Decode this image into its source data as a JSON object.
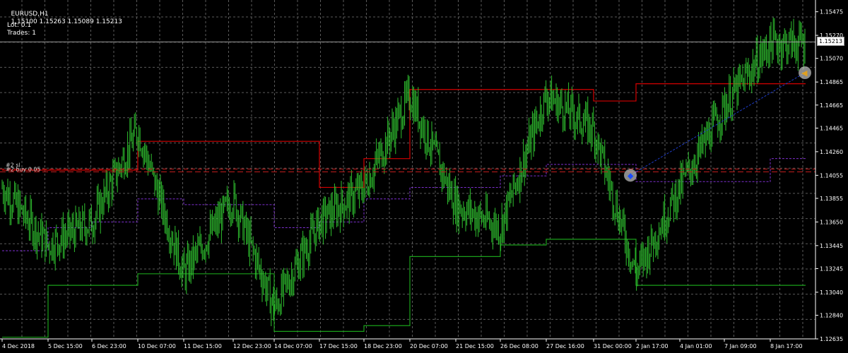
{
  "header": {
    "symbol": "EURUSD,H1",
    "ohlc": "1.15100 1.15263 1.15089 1.15213"
  },
  "overlay": {
    "lot": "Lot: 0.1",
    "trades": "Trades: 1",
    "sl_label": "#2 sl",
    "buy_label": "#2 buy 0.05"
  },
  "current_price": "1.15213",
  "colors": {
    "background": "#000000",
    "grid": "#5a5a5a",
    "candle": "#2fbf2f",
    "upper_band": "#d40000",
    "lower_band": "#1aa01a",
    "mid_band": "#7e2fd0",
    "order_line": "#c81e1e",
    "trend_line": "#1e3cc8",
    "order_marker": "#b8b8b8"
  },
  "chart_data": {
    "type": "line",
    "symbol": "EURUSD",
    "timeframe": "H1",
    "ylim": [
      1.12635,
      1.15577
    ],
    "y_ticks": [
      "1.15475",
      "1.15270",
      "1.15070",
      "1.14865",
      "1.14665",
      "1.14465",
      "1.14260",
      "1.14055",
      "1.13855",
      "1.13650",
      "1.13445",
      "1.13245",
      "1.13040",
      "1.12840",
      "1.12635"
    ],
    "x_ticks": [
      "4 Dec 2018",
      "5 Dec 15:00",
      "6 Dec 23:00",
      "10 Dec 07:00",
      "11 Dec 15:00",
      "12 Dec 23:00",
      "14 Dec 07:00",
      "17 Dec 15:00",
      "18 Dec 23:00",
      "20 Dec 07:00",
      "21 Dec 15:00",
      "26 Dec 08:00",
      "27 Dec 16:00",
      "31 Dec 00:00",
      "2 Jan 17:00",
      "4 Jan 01:00",
      "7 Jan 09:00",
      "8 Jan 17:00"
    ],
    "grid": true,
    "order_price": 1.14085,
    "sl_price": 1.1411,
    "entry": {
      "x": "31 Dec 00:00",
      "price": 1.14055
    },
    "series": [
      {
        "kind": "price",
        "x": [
          "4 Dec 2018",
          "5 Dec 15:00",
          "6 Dec 23:00",
          "10 Dec 07:00",
          "11 Dec 15:00",
          "12 Dec 23:00",
          "14 Dec 07:00",
          "17 Dec 15:00",
          "18 Dec 23:00",
          "20 Dec 07:00",
          "21 Dec 15:00",
          "26 Dec 08:00",
          "27 Dec 16:00",
          "31 Dec 00:00",
          "2 Jan 17:00",
          "4 Jan 01:00",
          "7 Jan 09:00",
          "8 Jan 17:00"
        ],
        "values": [
          1.1395,
          1.1345,
          1.1365,
          1.1445,
          1.132,
          1.1385,
          1.129,
          1.1365,
          1.1395,
          1.1475,
          1.138,
          1.136,
          1.1475,
          1.1445,
          1.132,
          1.1395,
          1.1465,
          1.152
        ]
      },
      {
        "kind": "upper_band",
        "x": [
          "4 Dec 2018",
          "6 Dec 23:00",
          "10 Dec 07:00",
          "12 Dec 23:00",
          "14 Dec 07:00",
          "17 Dec 15:00",
          "18 Dec 23:00",
          "20 Dec 07:00",
          "26 Dec 08:00",
          "27 Dec 16:00",
          "31 Dec 00:00",
          "2 Jan 17:00",
          "7 Jan 09:00",
          "8 Jan 17:00"
        ],
        "values": [
          1.141,
          1.141,
          1.1435,
          1.1435,
          1.1435,
          1.1395,
          1.142,
          1.148,
          1.148,
          1.148,
          1.147,
          1.1485,
          1.1485,
          1.1485
        ]
      },
      {
        "kind": "lower_band",
        "x": [
          "4 Dec 2018",
          "5 Dec 15:00",
          "6 Dec 23:00",
          "10 Dec 07:00",
          "11 Dec 15:00",
          "12 Dec 23:00",
          "14 Dec 07:00",
          "17 Dec 15:00",
          "18 Dec 23:00",
          "20 Dec 07:00",
          "21 Dec 15:00",
          "26 Dec 08:00",
          "27 Dec 16:00",
          "31 Dec 00:00",
          "2 Jan 17:00",
          "7 Jan 09:00",
          "8 Jan 17:00"
        ],
        "values": [
          1.1265,
          1.131,
          1.131,
          1.132,
          1.132,
          1.132,
          1.127,
          1.127,
          1.1275,
          1.1335,
          1.1335,
          1.1345,
          1.135,
          1.135,
          1.131,
          1.131,
          1.131
        ]
      },
      {
        "kind": "mid_band",
        "x": [
          "4 Dec 2018",
          "5 Dec 15:00",
          "6 Dec 23:00",
          "10 Dec 07:00",
          "11 Dec 15:00",
          "12 Dec 23:00",
          "14 Dec 07:00",
          "17 Dec 15:00",
          "18 Dec 23:00",
          "20 Dec 07:00",
          "21 Dec 15:00",
          "26 Dec 08:00",
          "27 Dec 16:00",
          "31 Dec 00:00",
          "2 Jan 17:00",
          "4 Jan 01:00",
          "7 Jan 09:00",
          "8 Jan 17:00"
        ],
        "values": [
          1.134,
          1.136,
          1.1365,
          1.1385,
          1.138,
          1.138,
          1.136,
          1.1365,
          1.1385,
          1.1395,
          1.1395,
          1.1405,
          1.1415,
          1.1415,
          1.14,
          1.14,
          1.14,
          1.142
        ]
      }
    ]
  }
}
